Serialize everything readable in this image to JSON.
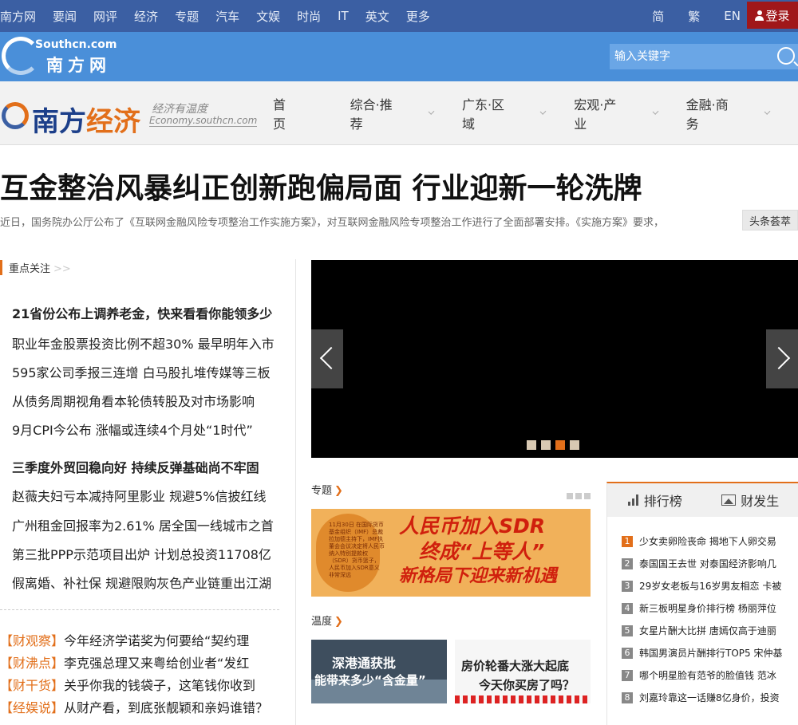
{
  "topnav": {
    "items": [
      "南方网",
      "要闻",
      "网评",
      "经济",
      "专题",
      "汽车",
      "文娱",
      "时尚",
      "IT",
      "英文",
      "更多"
    ],
    "lang": [
      "简",
      "繁",
      "EN"
    ],
    "login": "登录"
  },
  "header": {
    "logo_en": "Southcn.com",
    "logo_cn": "南方网",
    "search_placeholder": "输入关键字"
  },
  "channel": {
    "brand_a": "南方",
    "brand_b": "经济",
    "slogan": "经济有温度",
    "url": "Economy.southcn.com",
    "nav": [
      "首页",
      "综合·推荐",
      "广东·区域",
      "宏观·产业",
      "金融·商务"
    ]
  },
  "headline": {
    "title": "互金整治风暴纠正创新跑偏局面 行业迎新一轮洗牌",
    "summary": "近日，国务院办公厅公布了《互联网金融风险专项整治工作实施方案》，对互联网金融风险专项整治工作进行了全面部署安排。《实施方案》要求，",
    "tag": "头条荟萃"
  },
  "focus": {
    "title": "重点关注",
    "arrow": ">>",
    "items": [
      {
        "text": "21省份公布上调养老金，快来看看你能领多少",
        "bold": true
      },
      {
        "text": "职业年金股票投资比例不超30% 最早明年入市",
        "bold": false
      },
      {
        "text": "595家公司季报三连增 白马股扎堆传媒等三板",
        "bold": false
      },
      {
        "text": "从债务周期视角看本轮债转股及对市场影响",
        "bold": false
      },
      {
        "text": "9月CPI今公布 涨幅或连续4个月处“1时代”",
        "bold": false
      },
      {
        "text": "三季度外贸回稳向好 持续反弹基础尚不牢固",
        "bold": true
      },
      {
        "text": "赵薇夫妇亏本减持阿里影业 规避5%信披红线",
        "bold": false
      },
      {
        "text": "广州租金回报率为2.61% 居全国一线城市之首",
        "bold": false
      },
      {
        "text": "第三批PPP示范项目出炉 计划总投资11708亿",
        "bold": false
      },
      {
        "text": "假离婚、补社保 规避限购灰色产业链重出江湖",
        "bold": false
      }
    ]
  },
  "columns": [
    {
      "tag": "【财观察】",
      "text": "今年经济学诺奖为何要给“契约理"
    },
    {
      "tag": "【财沸点】",
      "text": "李克强总理又来粤给创业者“发红"
    },
    {
      "tag": "【财干货】",
      "text": "关乎你我的钱袋子，这笔钱你收到"
    },
    {
      "tag": "【经娱说】",
      "text": "从财产看，到底张靓颖和亲妈谁错？"
    }
  ],
  "special": {
    "title": "专题",
    "chev": "❯",
    "banner_small": "11月30日 在国际货币基金组织（IMF）总裁拉加德主持下，IMF执董会会议决定将人民币纳入特别提款权（SDR）货币篮子，人民币加入SDR意义非常深远",
    "banner_l1": "人民币加入SDR",
    "banner_l2": "终成“上等人”",
    "banner_l3": "新格局下迎来新机遇"
  },
  "warmth": {
    "title": "温度",
    "chev": "❯",
    "t1_line1": "深港通获批",
    "t1_line2": "能带来多少“含金量”",
    "t2_line1": "房价轮番大涨大起底",
    "t2_line2": "今天你买房了吗？"
  },
  "ranking": {
    "tab1": "排行榜",
    "tab2": "财发生",
    "items": [
      {
        "n": "1",
        "text": "少女卖卵险丧命 揭地下人卵交易"
      },
      {
        "n": "2",
        "text": "泰国国王去世 对泰国经济影响几"
      },
      {
        "n": "3",
        "text": "29岁女老板与16岁男友相恋 卡被"
      },
      {
        "n": "4",
        "text": "新三板明星身价排行榜 杨丽萍位"
      },
      {
        "n": "5",
        "text": "女星片酬大比拼 唐嫣仅高于迪丽"
      },
      {
        "n": "6",
        "text": "韩国男演员片酬排行TOP5 宋仲基"
      },
      {
        "n": "7",
        "text": "哪个明星脸有范爷的脸值钱 范冰"
      },
      {
        "n": "8",
        "text": "刘嘉玲靠这一话赚8亿身价，投资"
      }
    ]
  },
  "colors": {
    "topnav": "#3b5fa3",
    "band": "#4a8fd9",
    "accent": "#e26f1a",
    "login": "#a0171a"
  }
}
